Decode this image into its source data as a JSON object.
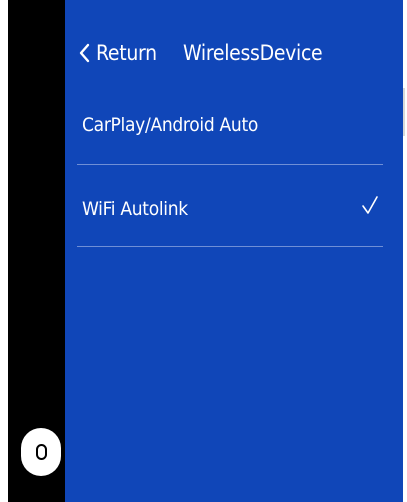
{
  "header": {
    "back_label": "Return",
    "title": "WirelessDevice"
  },
  "list": {
    "items": [
      {
        "label": "CarPlay/Android Auto",
        "selected": false
      },
      {
        "label": "WiFi Autolink",
        "selected": true
      }
    ]
  },
  "icons": {
    "back": "chevron-left-icon",
    "check": "checkmark-icon",
    "home": "home-button-icon"
  },
  "colors": {
    "panel_background": "#1046b8",
    "text": "#ffffff",
    "divider": "#6f8fd6",
    "side_bar": "#000000"
  }
}
